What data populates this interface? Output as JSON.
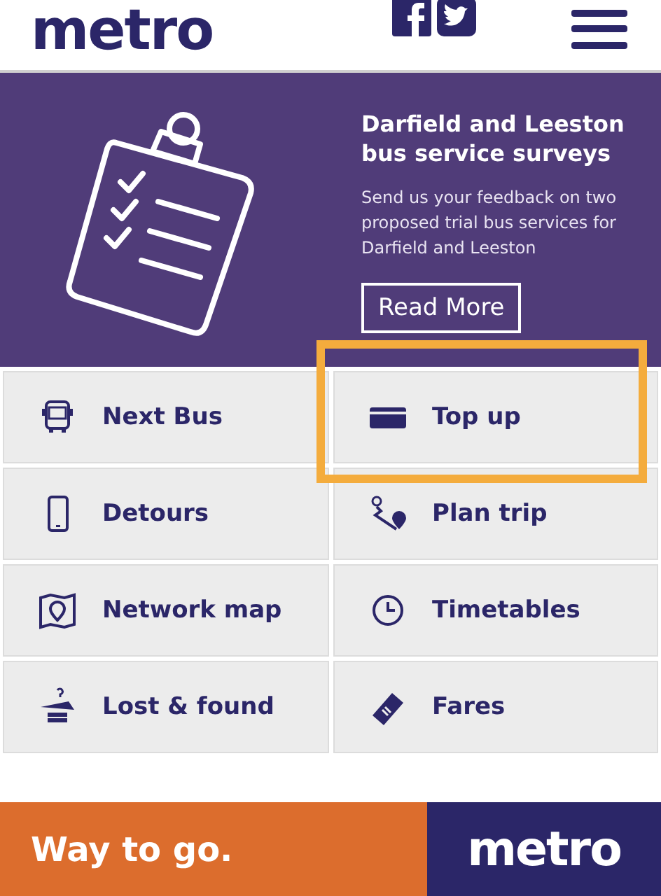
{
  "header": {
    "logo": "metro"
  },
  "banner": {
    "title": "Darfield and Leeston bus service surveys",
    "text": "Send us your feedback on two proposed trial bus services for Darfield and Leeston",
    "button": "Read More"
  },
  "tiles": [
    {
      "label": "Next Bus",
      "kind": "bus",
      "highlighted": false
    },
    {
      "label": "Top up",
      "kind": "card",
      "highlighted": true
    },
    {
      "label": "Detours",
      "kind": "phone",
      "highlighted": false
    },
    {
      "label": "Plan trip",
      "kind": "route",
      "highlighted": false
    },
    {
      "label": "Network map",
      "kind": "map",
      "highlighted": false
    },
    {
      "label": "Timetables",
      "kind": "clock",
      "highlighted": false
    },
    {
      "label": "Lost & found",
      "kind": "lost",
      "highlighted": false
    },
    {
      "label": "Fares",
      "kind": "ticket",
      "highlighted": false
    }
  ],
  "footer": {
    "slogan": "Way to go.",
    "logo": "metro"
  }
}
